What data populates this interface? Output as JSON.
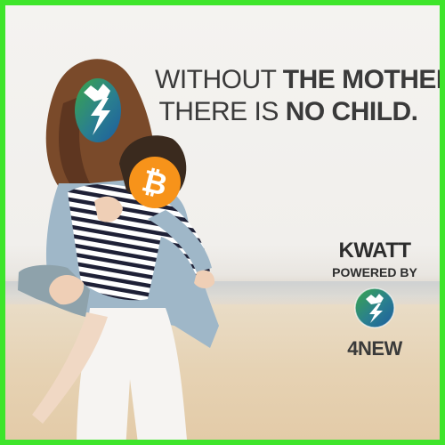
{
  "headline": {
    "line1_thin": "WITHOUT ",
    "line1_bold": "THE MOTHER",
    "line2_thin": "THERE IS ",
    "line2_bold": "NO CHILD."
  },
  "brand": {
    "name": "KWATT",
    "tagline": "POWERED BY",
    "logo_text": "4NEW"
  },
  "icons": {
    "mother_face": "4new-lightning-fist-icon",
    "child_face": "bitcoin-icon"
  },
  "colors": {
    "border": "#3ee52b",
    "bitcoin_orange": "#f7931a",
    "text_dark": "#2c2c2c"
  }
}
